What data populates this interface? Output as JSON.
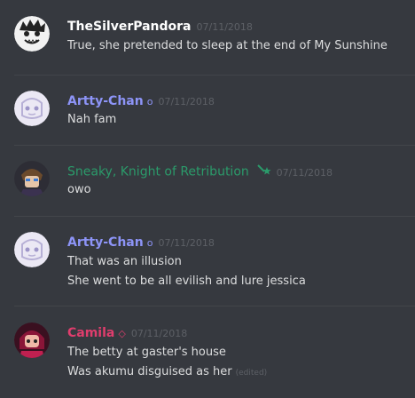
{
  "colors": {
    "background": "#36393f",
    "text": "#dcddde",
    "timestamp": "#5d6066",
    "pandora": "#ffffff",
    "artty": "#8d94f7",
    "sneaky": "#2b9a6a",
    "camila": "#e03d6d"
  },
  "messages": [
    {
      "author": "TheSilverPandora",
      "timestamp": "07/11/2018",
      "lines": [
        "True, she pretended to sleep at the end of My Sunshine"
      ]
    },
    {
      "author": "Artty-Chan",
      "badge": "o",
      "timestamp": "07/11/2018",
      "lines": [
        "Nah fam"
      ]
    },
    {
      "author": "Sneaky, Knight of Retribution",
      "badge_icon": "wand-star-icon",
      "timestamp": "07/11/2018",
      "lines": [
        "owo"
      ]
    },
    {
      "author": "Artty-Chan",
      "badge": "o",
      "timestamp": "07/11/2018",
      "lines": [
        "That was an illusion",
        "She went to be all evilish and lure jessica"
      ]
    },
    {
      "author": "Camila",
      "badge": "◇",
      "timestamp": "07/11/2018",
      "lines": [
        "The betty at gaster's house",
        "Was akumu disguised as her"
      ],
      "edited": "(edited)"
    }
  ]
}
